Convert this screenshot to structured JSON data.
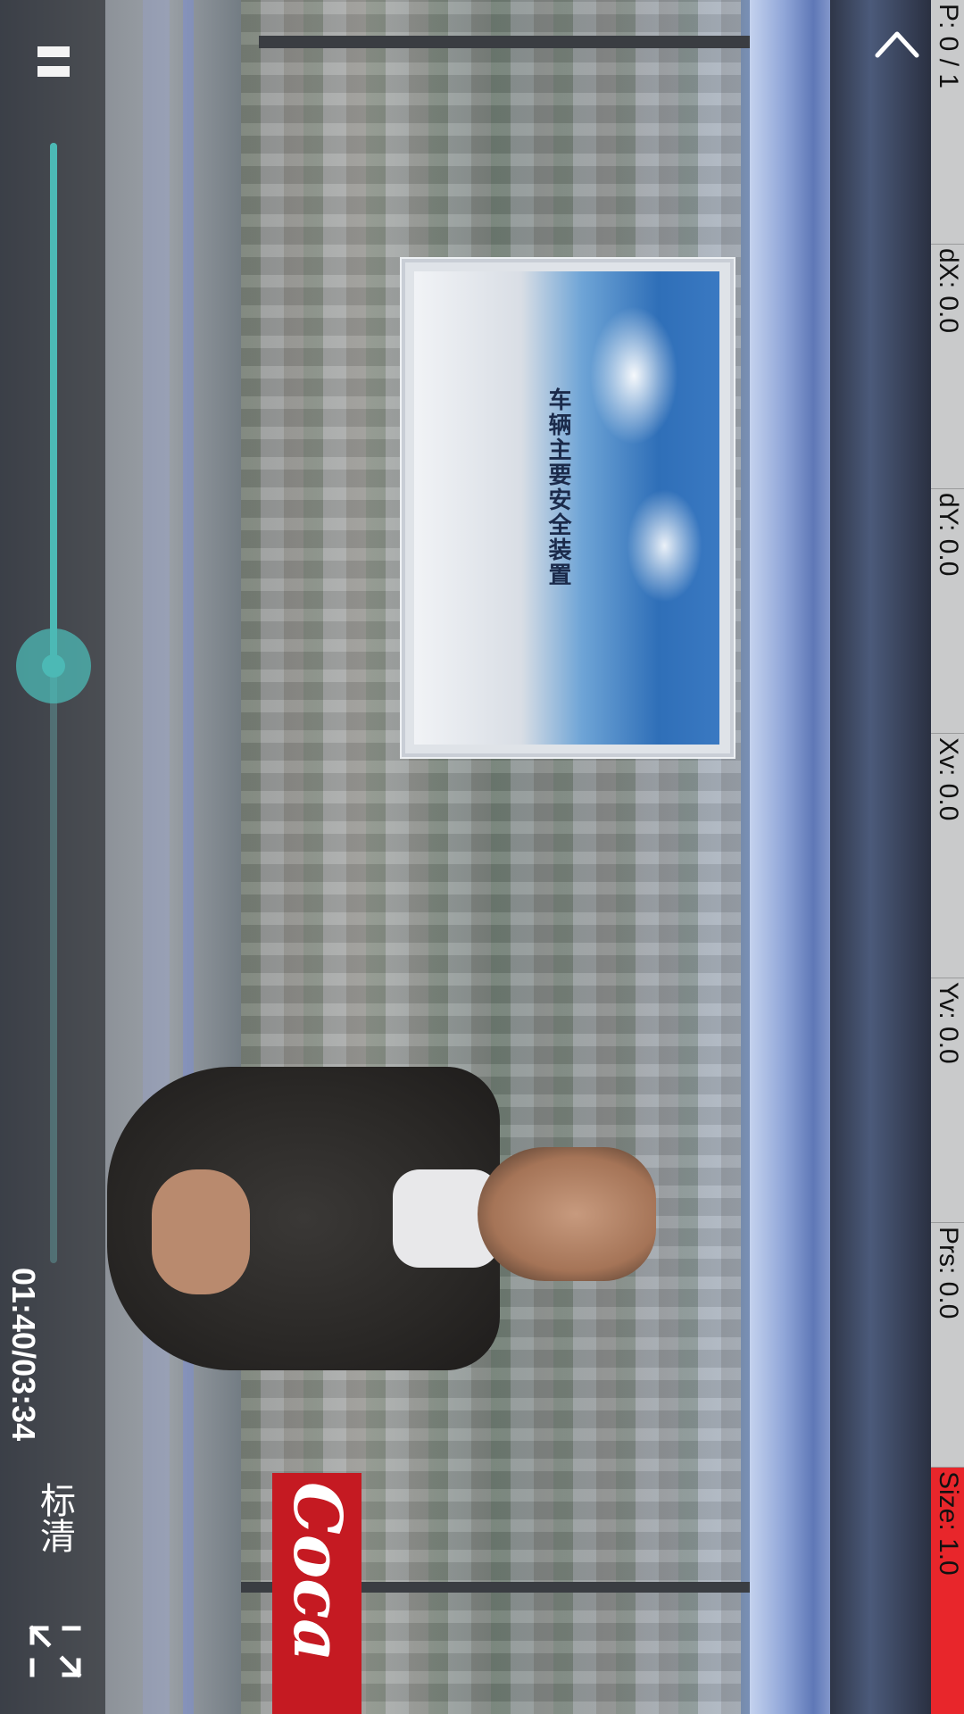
{
  "player": {
    "time_label": "01:40/03:34",
    "quality_label": "标清",
    "progress_fraction": 0.467,
    "icons": {
      "pause": "pause-icon",
      "fullscreen": "exit-fullscreen-icon",
      "back": "chevron-left-icon"
    }
  },
  "video": {
    "screen_caption": "车辆主要安全装置",
    "sign_text": "Coca"
  },
  "debug": {
    "items": [
      {
        "label": "P: 0 / 1"
      },
      {
        "label": "dX: 0.0"
      },
      {
        "label": "dY: 0.0"
      },
      {
        "label": "Xv: 0.0"
      },
      {
        "label": "Yv: 0.0"
      },
      {
        "label": "Prs: 0.0"
      },
      {
        "label": "Size: 1.0"
      }
    ],
    "highlight_color": "#e8262b"
  },
  "colors": {
    "accent": "#4cb9b5",
    "debug_background": "#c9cacb"
  }
}
